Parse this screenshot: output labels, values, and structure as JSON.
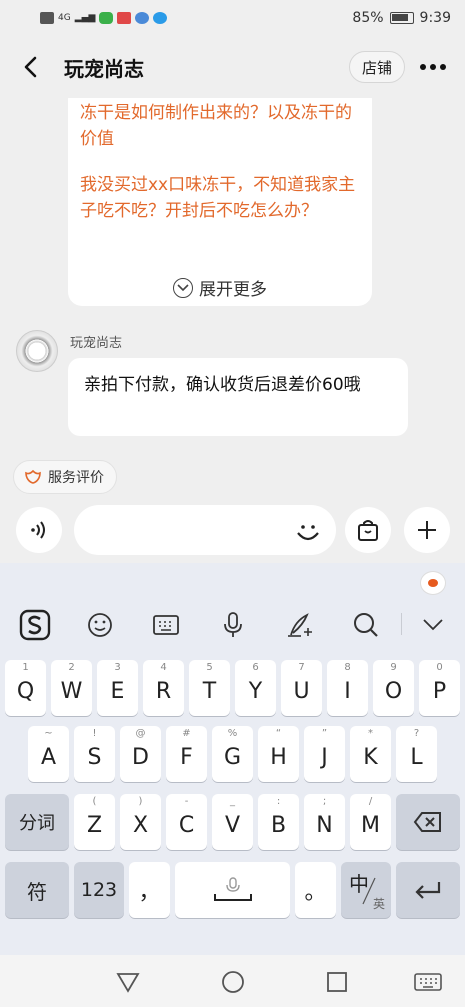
{
  "status_bar": {
    "battery": "85%",
    "time": "9:39",
    "network": "4G"
  },
  "header": {
    "title": "玩宠尚志",
    "shop_button": "店铺"
  },
  "chat": {
    "faq_card": {
      "question_1": "冻干是如何制作出来的？以及冻干的价值",
      "question_2": "我没买过xx口味冻干，不知道我家主子吃不吃？开封后不吃怎么办？",
      "expand": "展开更多"
    },
    "message": {
      "sender": "玩宠尚志",
      "text": "亲拍下付款，确认收货后退差价60哦"
    }
  },
  "service_eval": {
    "label": "服务评价"
  },
  "input": {
    "value": "",
    "placeholder": ""
  },
  "keyboard": {
    "row1": [
      {
        "hint": "1",
        "key": "Q"
      },
      {
        "hint": "2",
        "key": "W"
      },
      {
        "hint": "3",
        "key": "E"
      },
      {
        "hint": "4",
        "key": "R"
      },
      {
        "hint": "5",
        "key": "T"
      },
      {
        "hint": "6",
        "key": "Y"
      },
      {
        "hint": "7",
        "key": "U"
      },
      {
        "hint": "8",
        "key": "I"
      },
      {
        "hint": "9",
        "key": "O"
      },
      {
        "hint": "0",
        "key": "P"
      }
    ],
    "row2": [
      {
        "hint": "~",
        "key": "A"
      },
      {
        "hint": "!",
        "key": "S"
      },
      {
        "hint": "@",
        "key": "D"
      },
      {
        "hint": "#",
        "key": "F"
      },
      {
        "hint": "%",
        "key": "G"
      },
      {
        "hint": "“",
        "key": "H"
      },
      {
        "hint": "”",
        "key": "J"
      },
      {
        "hint": "*",
        "key": "K"
      },
      {
        "hint": "?",
        "key": "L"
      }
    ],
    "row3": [
      {
        "hint": "(",
        "key": "Z"
      },
      {
        "hint": ")",
        "key": "X"
      },
      {
        "hint": "-",
        "key": "C"
      },
      {
        "hint": "_",
        "key": "V"
      },
      {
        "hint": ":",
        "key": "B"
      },
      {
        "hint": ";",
        "key": "N"
      },
      {
        "hint": "/",
        "key": "M"
      }
    ],
    "split_key": "分词",
    "symbol_key": "符",
    "number_key": "123",
    "comma_key": "，",
    "period_key": "。",
    "lang_key_main": "中",
    "lang_key_sub": "英"
  },
  "colors": {
    "faq_text": "#e2692c",
    "background": "#efefef",
    "keyboard_bg": "#e9ecf3"
  }
}
